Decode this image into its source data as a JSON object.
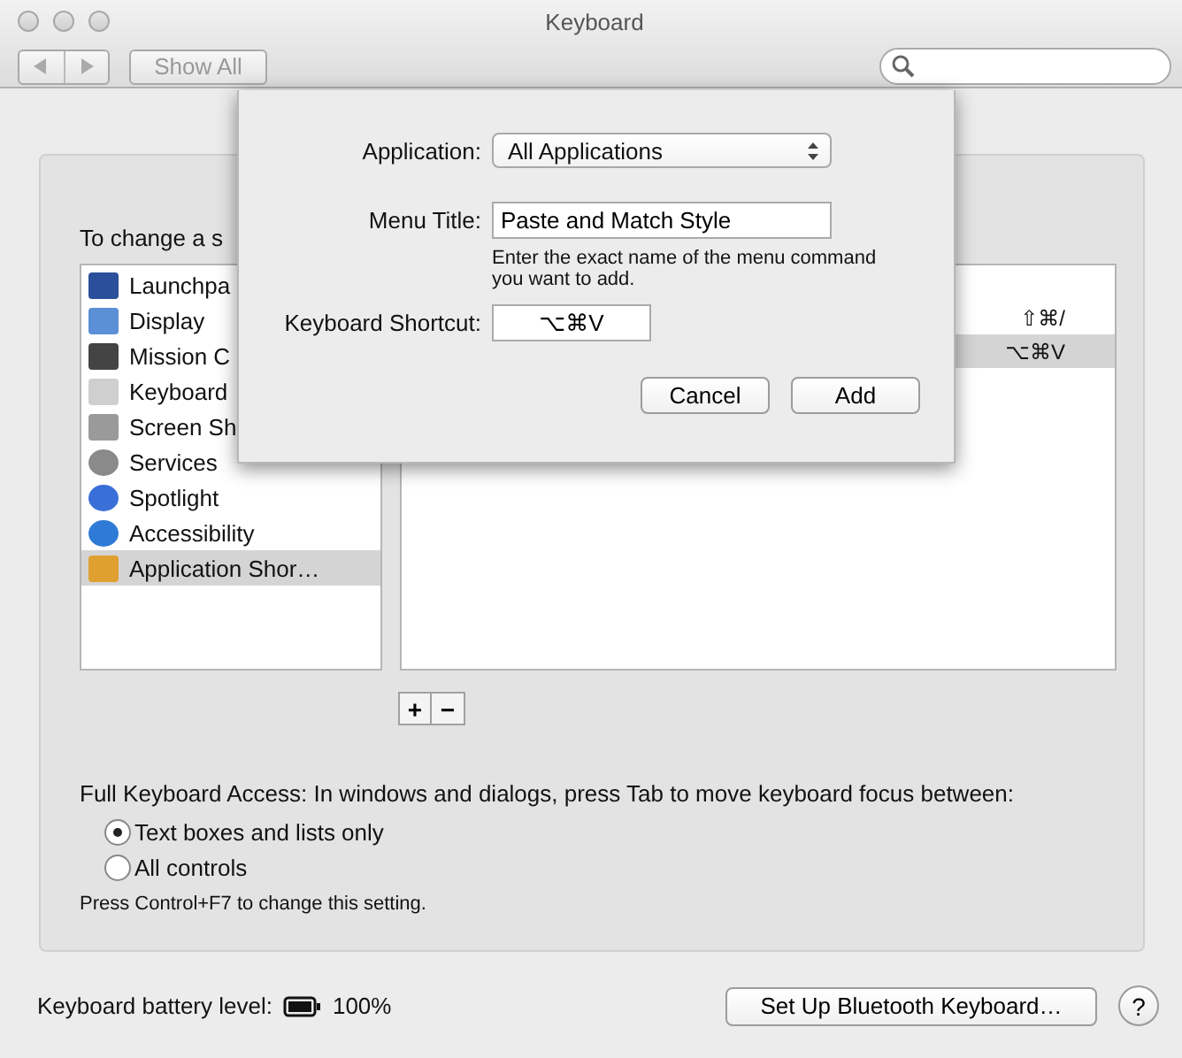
{
  "window": {
    "title": "Keyboard"
  },
  "toolbar": {
    "show_all": "Show All"
  },
  "instruction": "To change a s",
  "categories": [
    {
      "label": "Launchpa",
      "selected": false
    },
    {
      "label": "Display",
      "selected": false
    },
    {
      "label": "Mission C",
      "selected": false
    },
    {
      "label": "Keyboard",
      "selected": false
    },
    {
      "label": "Screen Sh",
      "selected": false
    },
    {
      "label": "Services",
      "selected": false
    },
    {
      "label": "Spotlight",
      "selected": false
    },
    {
      "label": "Accessibility",
      "selected": false
    },
    {
      "label": "Application Shor…",
      "selected": true
    }
  ],
  "shortcuts": [
    {
      "keys": "⇧⌘/",
      "selected": false
    },
    {
      "keys": "⌥⌘V",
      "selected": true
    }
  ],
  "list_buttons": [
    "+",
    "−"
  ],
  "keyboard_access": {
    "label": "Full Keyboard Access: In windows and dialogs, press Tab to move keyboard focus between:",
    "options": [
      {
        "label": "Text boxes and lists only",
        "selected": true
      },
      {
        "label": "All controls",
        "selected": false
      }
    ],
    "hint": "Press Control+F7 to change this setting."
  },
  "battery": {
    "label": "Keyboard battery level:",
    "reading": "100%"
  },
  "bluetooth_button": "Set Up Bluetooth Keyboard…",
  "help_button": "?",
  "sheet": {
    "application": {
      "label": "Application:",
      "value": "All Applications"
    },
    "menu_title": {
      "label": "Menu Title:",
      "value": "Paste and Match Style",
      "hint": "Enter the exact name of the menu command you want to add."
    },
    "shortcut": {
      "label": "Keyboard Shortcut:",
      "value": "⌥⌘V"
    },
    "buttons": [
      "Cancel",
      "Add"
    ]
  }
}
